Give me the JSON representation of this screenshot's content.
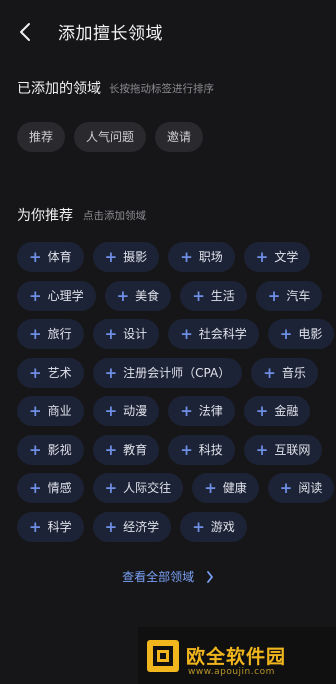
{
  "header": {
    "title": "添加擅长领域"
  },
  "added": {
    "title": "已添加的领域",
    "hint": "长按拖动标签进行排序",
    "tags": [
      "推荐",
      "人气问题",
      "邀请"
    ]
  },
  "recommend": {
    "title": "为你推荐",
    "hint": "点击添加领域",
    "rows": [
      [
        "体育",
        "摄影",
        "职场",
        "文学"
      ],
      [
        "心理学",
        "美食",
        "生活",
        "汽车"
      ],
      [
        "旅行",
        "设计",
        "社会科学",
        "电影"
      ],
      [
        "艺术",
        "注册会计师（CPA）",
        "音乐"
      ],
      [
        "商业",
        "动漫",
        "法律",
        "金融"
      ],
      [
        "影视",
        "教育",
        "科技",
        "互联网"
      ],
      [
        "情感",
        "人际交往",
        "健康",
        "阅读"
      ],
      [
        "科学",
        "经济学",
        "游戏"
      ]
    ]
  },
  "view_all": "查看全部领域",
  "watermark": {
    "name": "欧全软件园",
    "url": "www.apoujin.com"
  },
  "colors": {
    "accent": "#7aa0f5",
    "chip_bg": "#1d2336",
    "bg": "#161618"
  }
}
